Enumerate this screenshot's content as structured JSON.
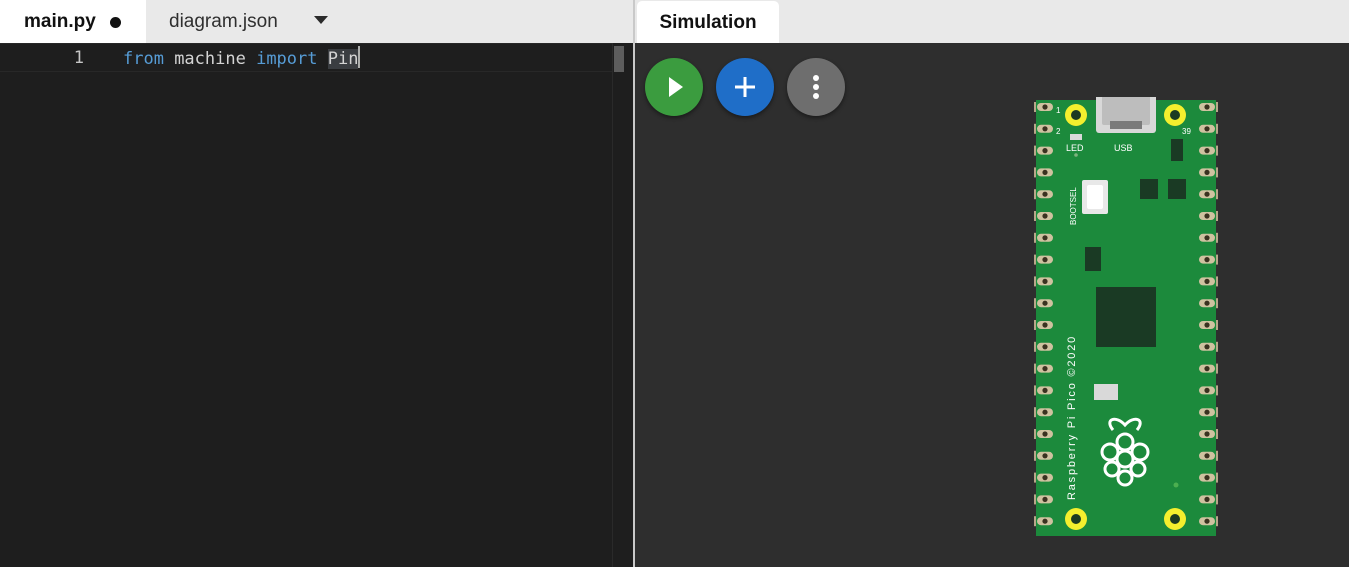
{
  "editor": {
    "tabs": [
      {
        "label": "main.py",
        "modified": true
      },
      {
        "label": "diagram.json"
      }
    ],
    "dropdown_icon": "caret-down-icon",
    "lines": [
      {
        "number": "1",
        "tokens": [
          {
            "text": "from",
            "kind": "keyword"
          },
          {
            "text": " machine ",
            "kind": "plain"
          },
          {
            "text": "import",
            "kind": "keyword"
          },
          {
            "text": " ",
            "kind": "plain"
          },
          {
            "text": "Pin",
            "kind": "plain"
          }
        ]
      }
    ]
  },
  "simulation": {
    "tab_label": "Simulation",
    "buttons": [
      {
        "name": "start-simulation",
        "icon": "play-icon",
        "color": "#3b9c3f"
      },
      {
        "name": "add-part",
        "icon": "plus-icon",
        "color": "#1f6ec8"
      },
      {
        "name": "more-options",
        "icon": "kebab-icon",
        "color": "#6e6e6e"
      }
    ],
    "board": {
      "part": "Raspberry Pi Pico",
      "silkscreen": {
        "pin1": "1",
        "pin2": "2",
        "pin39": "39",
        "led": "LED",
        "usb": "USB",
        "bootsel": "BOOTSEL",
        "vertical": "Raspberry Pi Pico ©2020"
      },
      "colors": {
        "pcb": "#1c8a3c",
        "pad": "#f4ef2e",
        "castellation": "#b8a88a"
      }
    }
  },
  "theme": {
    "editor_bg": "#1e1e1e",
    "keyword": "#569cd6",
    "sim_bg": "#2e2e2e"
  }
}
